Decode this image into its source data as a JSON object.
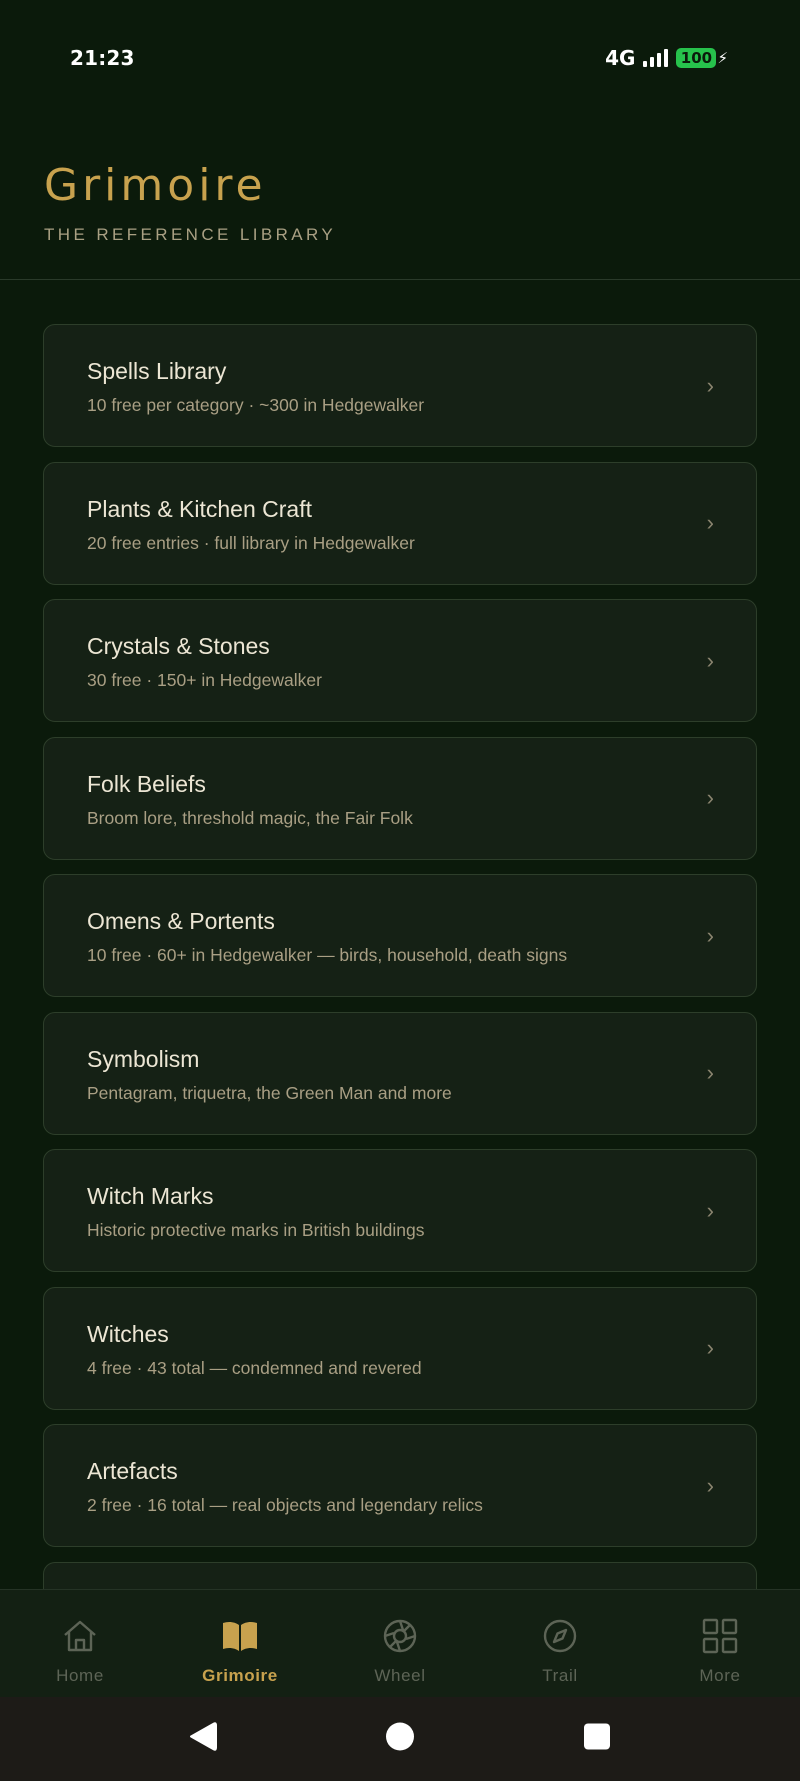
{
  "status_bar": {
    "time": "21:23",
    "network": "4G",
    "battery": "100"
  },
  "header": {
    "title": "Grimoire",
    "subtitle": "THE REFERENCE LIBRARY"
  },
  "items": [
    {
      "title": "Spells Library",
      "desc": "10 free per category · ~300 in Hedgewalker"
    },
    {
      "title": "Plants & Kitchen Craft",
      "desc": "20 free entries · full library in Hedgewalker"
    },
    {
      "title": "Crystals & Stones",
      "desc": "30 free · 150+ in Hedgewalker"
    },
    {
      "title": "Folk Beliefs",
      "desc": "Broom lore, threshold magic, the Fair Folk"
    },
    {
      "title": "Omens & Portents",
      "desc": "10 free · 60+ in Hedgewalker — birds, household, death signs"
    },
    {
      "title": "Symbolism",
      "desc": "Pentagram, triquetra, the Green Man and more"
    },
    {
      "title": "Witch Marks",
      "desc": "Historic protective marks in British buildings"
    },
    {
      "title": "Witches",
      "desc": "4 free · 43 total — condemned and revered"
    },
    {
      "title": "Artefacts",
      "desc": "2 free · 16 total — real objects and legendary relics"
    }
  ],
  "chevron": "›",
  "nav": {
    "home": "Home",
    "grimoire": "Grimoire",
    "wheel": "Wheel",
    "trail": "Trail",
    "more": "More"
  },
  "colors": {
    "background": "#0b1a0b",
    "card": "#152115",
    "accent_gold": "#c8a24e",
    "battery_green": "#27c24c"
  },
  "icons": [
    "home-icon",
    "book-icon",
    "wheel-icon",
    "compass-icon",
    "grid-icon",
    "back-icon",
    "home-circle-icon",
    "recents-icon"
  ]
}
